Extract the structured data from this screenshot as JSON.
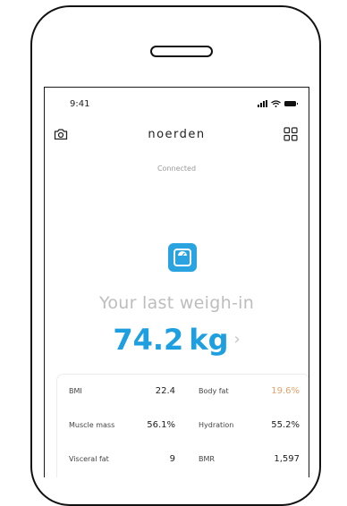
{
  "status_bar": {
    "time": "9:41"
  },
  "header": {
    "brand": "noerden"
  },
  "connection": {
    "status": "Connected"
  },
  "hero": {
    "caption": "Your last weigh-in",
    "weight_value": "74.2",
    "weight_unit": "kg",
    "chevron": "›"
  },
  "metrics": [
    {
      "label": "BMI",
      "value": "22.4"
    },
    {
      "label": "Body fat",
      "value": "19.6%",
      "accent": "#e3a16a"
    },
    {
      "label": "Muscle mass",
      "value": "56.1%"
    },
    {
      "label": "Hydration",
      "value": "55.2%"
    },
    {
      "label": "Visceral fat",
      "value": "9"
    },
    {
      "label": "BMR",
      "value": "1,597"
    }
  ],
  "icons": {
    "camera": "camera-icon",
    "grid": "grid-menu-icon",
    "scale": "scale-icon"
  },
  "colors": {
    "accent": "#2aa4e0",
    "weight": "#1d9fe0",
    "body_fat": "#e3a16a"
  }
}
